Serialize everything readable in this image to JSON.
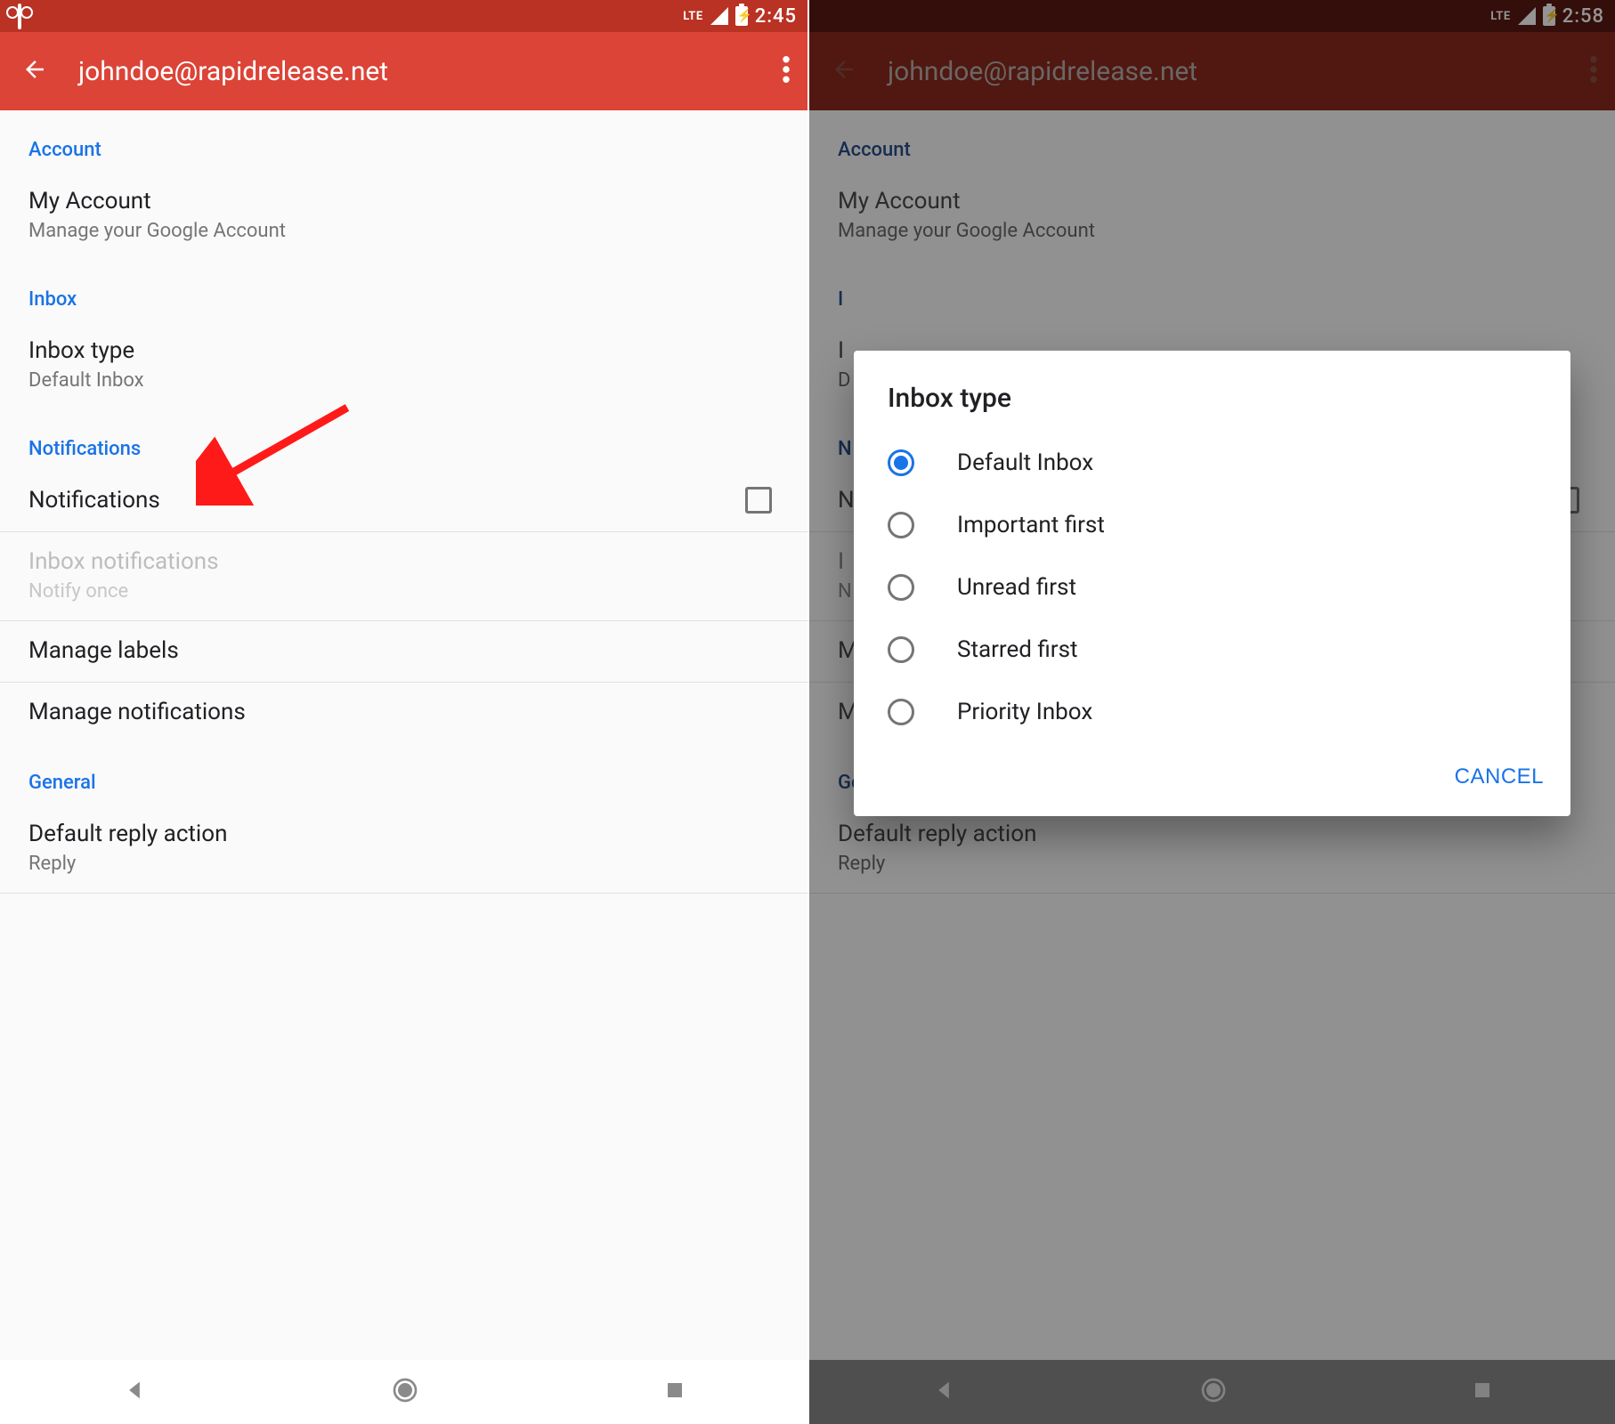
{
  "left": {
    "status": {
      "time": "2:45",
      "lte": "LTE"
    },
    "header": {
      "title": "johndoe@rapidrelease.net"
    },
    "sections": {
      "account": {
        "header": "Account",
        "my_account_title": "My Account",
        "my_account_sub": "Manage your Google Account"
      },
      "inbox": {
        "header": "Inbox",
        "inbox_type_title": "Inbox type",
        "inbox_type_sub": "Default Inbox"
      },
      "notifications": {
        "header": "Notifications",
        "notifications_title": "Notifications",
        "inbox_notifs_title": "Inbox notifications",
        "inbox_notifs_sub": "Notify once",
        "manage_labels": "Manage labels",
        "manage_notifications": "Manage notifications"
      },
      "general": {
        "header": "General",
        "default_reply_title": "Default reply action",
        "default_reply_sub": "Reply"
      }
    }
  },
  "right": {
    "status": {
      "time": "2:58",
      "lte": "LTE"
    },
    "header": {
      "title": "johndoe@rapidrelease.net"
    },
    "sections": {
      "account": {
        "header": "Account",
        "my_account_title": "My Account",
        "my_account_sub": "Manage your Google Account"
      },
      "inbox": {
        "header": "I",
        "inbox_type_title": "I",
        "inbox_type_sub": "D"
      },
      "notifications": {
        "header": "N",
        "notifications_title": "N",
        "inbox_notifs_title": "I",
        "inbox_notifs_sub": "N",
        "manage_labels": "M",
        "manage_notifications": "Manage notifications"
      },
      "general": {
        "header": "General",
        "default_reply_title": "Default reply action",
        "default_reply_sub": "Reply"
      }
    },
    "dialog": {
      "title": "Inbox type",
      "options": [
        {
          "label": "Default Inbox",
          "selected": true
        },
        {
          "label": "Important first",
          "selected": false
        },
        {
          "label": "Unread first",
          "selected": false
        },
        {
          "label": "Starred first",
          "selected": false
        },
        {
          "label": "Priority Inbox",
          "selected": false
        }
      ],
      "cancel": "CANCEL"
    }
  }
}
